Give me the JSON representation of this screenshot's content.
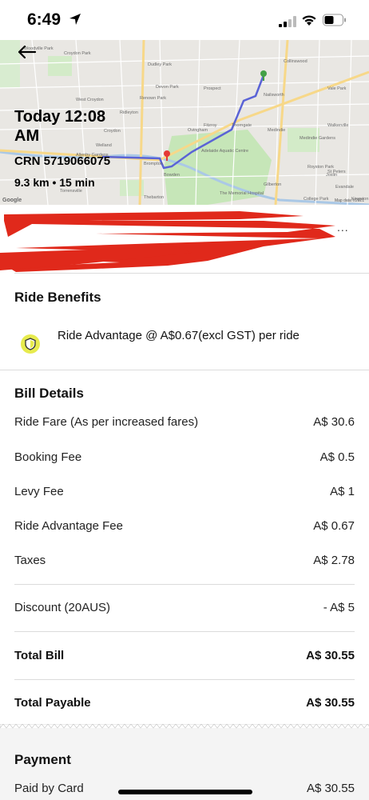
{
  "status_bar": {
    "time": "6:49"
  },
  "map": {
    "ride_time": "Today 12:08 AM",
    "crn": "CRN 5719066075",
    "distance_duration": "9.3 km • 15 min",
    "places": [
      "Woodville Park",
      "Croydon Park",
      "Dudley Park",
      "Devon Park",
      "Renown Park",
      "Prospect",
      "Nailsworth",
      "Collinswood",
      "Vale Park",
      "West Croydon",
      "Ridleyton",
      "Fitzroy",
      "Medindie Gardens",
      "Walkerville",
      "Croydon",
      "Ovingham",
      "Thorngate",
      "Medindie",
      "Royston Park",
      "Welland",
      "Brompton",
      "Adelaide Aquatic Centre",
      "St Peters",
      "Allenby Gardens",
      "Bowden",
      "Gilberton",
      "Joslin",
      "Evandale",
      "College Park",
      "Torrensville",
      "Thebarton",
      "The Memorial Hospital",
      "Kingston Norwood Bowling Club"
    ],
    "copyright": "Map data ©2021",
    "google": "Google"
  },
  "driver": {
    "more": "..."
  },
  "ride_benefits": {
    "title": "Ride Benefits",
    "text": "Ride Advantage @ A$0.67(excl GST) per ride"
  },
  "bill": {
    "title": "Bill Details",
    "rows": [
      {
        "label": "Ride Fare (As per increased fares)",
        "value": "A$ 30.6"
      },
      {
        "label": "Booking Fee",
        "value": "A$ 0.5"
      },
      {
        "label": "Levy Fee",
        "value": "A$ 1"
      },
      {
        "label": "Ride Advantage Fee",
        "value": "A$ 0.67"
      },
      {
        "label": "Taxes",
        "value": "A$ 2.78"
      }
    ],
    "discount": {
      "label": "Discount (20AUS)",
      "value": "- A$ 5"
    },
    "total_bill": {
      "label": "Total Bill",
      "value": "A$ 30.55"
    },
    "total_payable": {
      "label": "Total Payable",
      "value": "A$ 30.55"
    }
  },
  "payment": {
    "title": "Payment",
    "method": "Paid by Card",
    "amount": "A$ 30.55"
  },
  "colors": {
    "route": "#5a63d6",
    "park": "#c6e6b8",
    "benefit_badge": "#e7eb4e",
    "redaction": "#e0291b"
  }
}
